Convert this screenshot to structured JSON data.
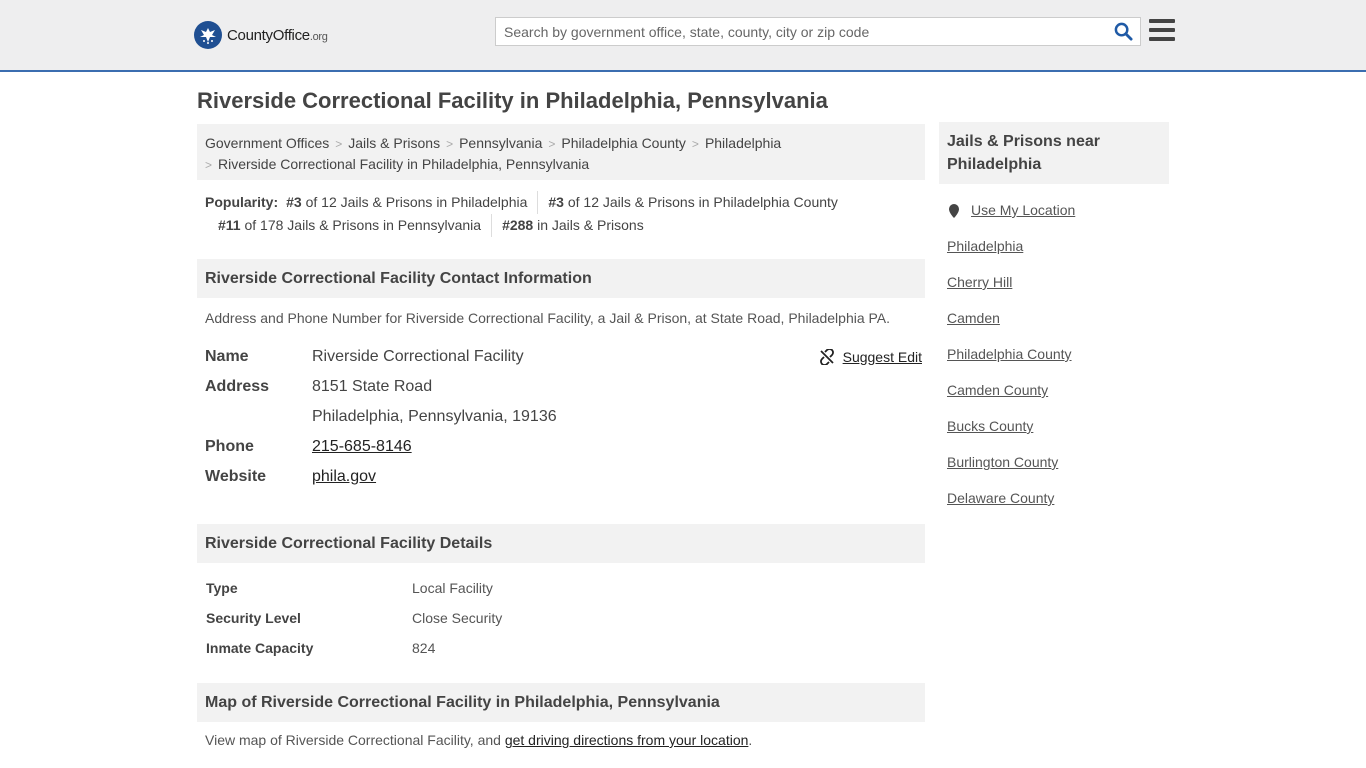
{
  "header": {
    "logo": {
      "brand": "CountyOffice",
      "tld": ".org"
    },
    "search": {
      "placeholder": "Search by government office, state, county, city or zip code",
      "value": ""
    }
  },
  "page_title": "Riverside Correctional Facility in Philadelphia, Pennsylvania",
  "breadcrumb": {
    "items": [
      "Government Offices",
      "Jails & Prisons",
      "Pennsylvania",
      "Philadelphia County",
      "Philadelphia"
    ],
    "current": "Riverside Correctional Facility in Philadelphia, Pennsylvania"
  },
  "popularity": {
    "label": "Popularity:",
    "items": [
      {
        "rank": "#3",
        "text": "of 12 Jails & Prisons in Philadelphia"
      },
      {
        "rank": "#3",
        "text": "of 12 Jails & Prisons in Philadelphia County"
      },
      {
        "rank": "#11",
        "text": "of 178 Jails & Prisons in Pennsylvania"
      },
      {
        "rank": "#288",
        "text": "in Jails & Prisons"
      }
    ]
  },
  "contact": {
    "heading": "Riverside Correctional Facility Contact Information",
    "description": "Address and Phone Number for Riverside Correctional Facility, a Jail & Prison, at State Road, Philadelphia PA.",
    "suggest_edit": "Suggest Edit",
    "name_label": "Name",
    "name": "Riverside Correctional Facility",
    "address_label": "Address",
    "address_line1": "8151 State Road",
    "address_line2": "Philadelphia, Pennsylvania, 19136",
    "phone_label": "Phone",
    "phone": "215-685-8146",
    "website_label": "Website",
    "website": "phila.gov"
  },
  "details": {
    "heading": "Riverside Correctional Facility Details",
    "rows": [
      {
        "label": "Type",
        "value": "Local Facility"
      },
      {
        "label": "Security Level",
        "value": "Close Security"
      },
      {
        "label": "Inmate Capacity",
        "value": "824"
      }
    ]
  },
  "map": {
    "heading": "Map of Riverside Correctional Facility in Philadelphia, Pennsylvania",
    "text_before": "View map of Riverside Correctional Facility, and ",
    "link": "get driving directions from your location",
    "text_after": "."
  },
  "sidebar": {
    "heading": "Jails & Prisons near Philadelphia",
    "use_location": "Use My Location",
    "links": [
      "Philadelphia",
      "Cherry Hill",
      "Camden",
      "Philadelphia County",
      "Camden County",
      "Bucks County",
      "Burlington County",
      "Delaware County"
    ]
  },
  "colors": {
    "accent": "#3b6db0",
    "logo": "#1f4f92",
    "panel": "#f2f2f2",
    "header_bg": "#eeeeef"
  }
}
